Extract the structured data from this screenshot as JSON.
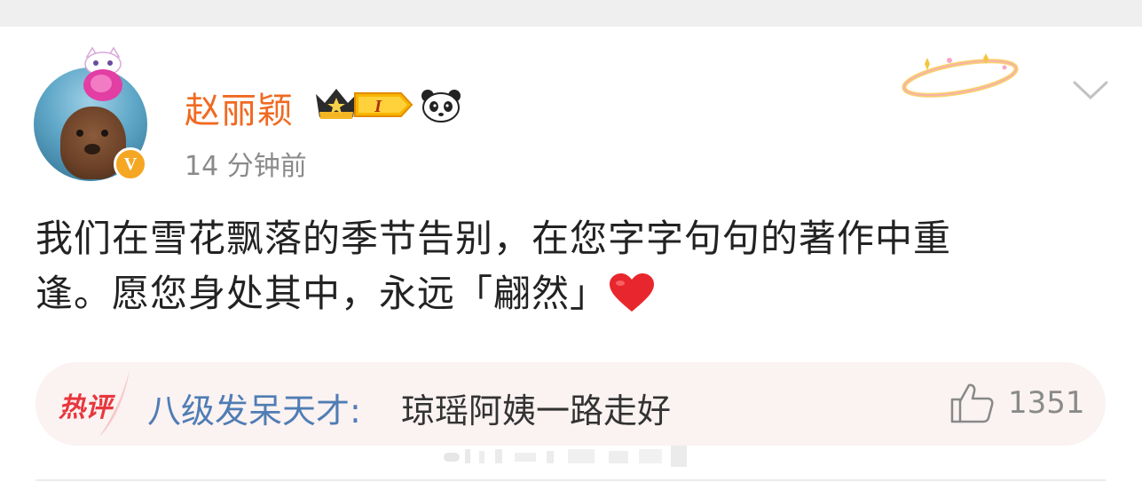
{
  "post": {
    "author": "赵丽颖",
    "level_badge": "I",
    "time": "14 分钟前",
    "text_line1": "我们在雪花飘落的季节告别，在您字字句句的著作中重",
    "text_line2": "逢。愿您身处其中，永远「翩然」"
  },
  "hot_comment": {
    "tag": "热评",
    "user": "八级发呆天才:",
    "text": "琼瑶阿姨一路走好",
    "likes": "1351"
  },
  "icons": {
    "verified": "verified-v-badge-icon",
    "crown": "vip-crown-icon",
    "panda": "panda-icon",
    "more": "chevron-down-icon",
    "like": "thumbs-up-icon",
    "heart": "red-heart-emoji"
  },
  "colors": {
    "username": "#f06a22",
    "comment_user": "#4f7db4",
    "hot_tag": "#e8363d",
    "comment_bg": "#fbf2f2",
    "verified": "#f5a623"
  }
}
